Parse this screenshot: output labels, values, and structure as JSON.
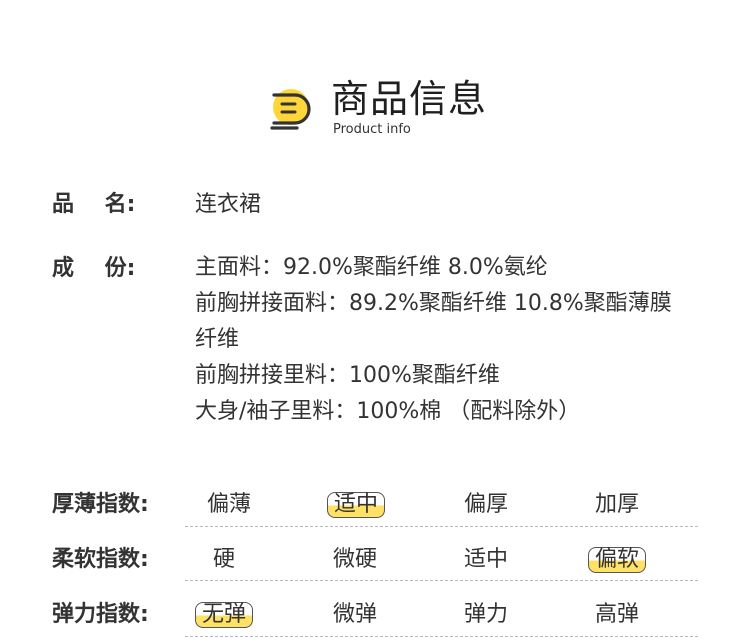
{
  "header": {
    "title": "商品信息",
    "subtitle": "Product info",
    "icon": "document-lines-icon",
    "accent_color": "#ffd63a"
  },
  "product_name": {
    "label": "品    名:",
    "value": "连衣裙"
  },
  "composition": {
    "label": "成    份:",
    "lines": [
      "主面料：92.0%聚酯纤维 8.0%氨纶",
      "前胸拼接面料：89.2%聚酯纤维 10.8%聚酯薄膜",
      "纤维",
      "前胸拼接里料：100%聚酯纤维",
      "大身/袖子里料：100%棉 （配料除外）"
    ]
  },
  "indices": [
    {
      "label": "厚薄指数:",
      "options": [
        "偏薄",
        "适中",
        "偏厚",
        "加厚"
      ],
      "selected": 1
    },
    {
      "label": "柔软指数:",
      "options": [
        "硬",
        "微硬",
        "适中",
        "偏软"
      ],
      "selected": 3
    },
    {
      "label": "弹力指数:",
      "options": [
        "无弹",
        "微弹",
        "弹力",
        "高弹"
      ],
      "selected": 0
    }
  ]
}
